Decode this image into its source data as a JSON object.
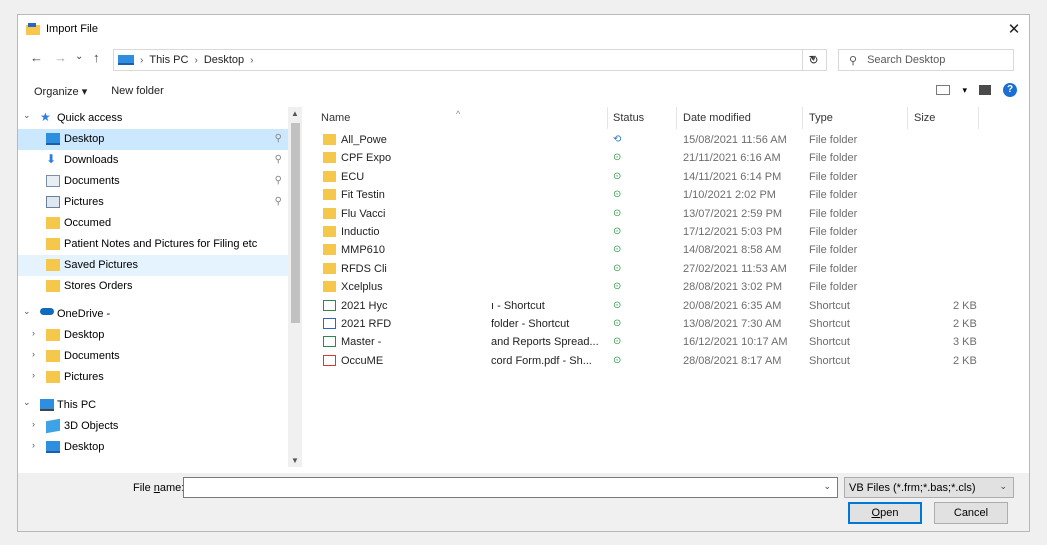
{
  "window": {
    "title": "Import File",
    "close_glyph": "✕"
  },
  "nav": {
    "back": "←",
    "forward": "→",
    "recent": "⌄",
    "up": "↑",
    "breadcrumb": [
      "This PC",
      "Desktop"
    ],
    "separator": "›",
    "refresh": "↻",
    "search_placeholder": "Search Desktop"
  },
  "toolbar": {
    "organize": "Organize ▾",
    "new_folder": "New folder",
    "view_arrow": "▾",
    "help": "?"
  },
  "sidebar": {
    "items": [
      {
        "label": "Quick access",
        "kind": "quick",
        "pinned": false
      },
      {
        "label": "Desktop",
        "kind": "desktop",
        "pinned": true
      },
      {
        "label": "Downloads",
        "kind": "download",
        "pinned": true
      },
      {
        "label": "Documents",
        "kind": "doc",
        "pinned": true
      },
      {
        "label": "Pictures",
        "kind": "pic",
        "pinned": true
      },
      {
        "label": "Occumed",
        "kind": "folder",
        "pinned": false
      },
      {
        "label": "Patient Notes and Pictures for Filing etc",
        "kind": "folder",
        "pinned": false
      },
      {
        "label": "Saved Pictures",
        "kind": "folder",
        "pinned": false
      },
      {
        "label": "Stores Orders",
        "kind": "folder",
        "pinned": false
      },
      {
        "label": "OneDrive -",
        "kind": "cloud",
        "pinned": false
      },
      {
        "label": "Desktop",
        "kind": "folder",
        "pinned": false
      },
      {
        "label": "Documents",
        "kind": "folder",
        "pinned": false
      },
      {
        "label": "Pictures",
        "kind": "folder",
        "pinned": false
      },
      {
        "label": "This PC",
        "kind": "pc",
        "pinned": false
      },
      {
        "label": "3D Objects",
        "kind": "cube",
        "pinned": false
      },
      {
        "label": "Desktop",
        "kind": "desktop",
        "pinned": false
      }
    ]
  },
  "columns": {
    "name": "Name",
    "status": "Status",
    "date": "Date modified",
    "type": "Type",
    "size": "Size"
  },
  "files": [
    {
      "name": "All_Powe",
      "name2": "",
      "status": "sync",
      "date": "15/08/2021 11:56 AM",
      "type": "File folder",
      "size": "",
      "kind": "folder"
    },
    {
      "name": "CPF Expo",
      "name2": "",
      "status": "ok",
      "date": "21/11/2021 6:16 AM",
      "type": "File folder",
      "size": "",
      "kind": "folder"
    },
    {
      "name": "ECU",
      "name2": "",
      "status": "ok",
      "date": "14/11/2021 6:14 PM",
      "type": "File folder",
      "size": "",
      "kind": "folder"
    },
    {
      "name": "Fit Testin",
      "name2": "",
      "status": "ok",
      "date": "1/10/2021 2:02 PM",
      "type": "File folder",
      "size": "",
      "kind": "folder"
    },
    {
      "name": "Flu Vacci",
      "name2": "",
      "status": "ok",
      "date": "13/07/2021 2:59 PM",
      "type": "File folder",
      "size": "",
      "kind": "folder"
    },
    {
      "name": "Inductio",
      "name2": "",
      "status": "ok",
      "date": "17/12/2021 5:03 PM",
      "type": "File folder",
      "size": "",
      "kind": "folder"
    },
    {
      "name": "MMP610",
      "name2": "",
      "status": "ok",
      "date": "14/08/2021 8:58 AM",
      "type": "File folder",
      "size": "",
      "kind": "folder"
    },
    {
      "name": "RFDS Cli",
      "name2": "",
      "status": "ok",
      "date": "27/02/2021 11:53 AM",
      "type": "File folder",
      "size": "",
      "kind": "folder"
    },
    {
      "name": "Xcelplus",
      "name2": "",
      "status": "ok",
      "date": "28/08/2021 3:02 PM",
      "type": "File folder",
      "size": "",
      "kind": "folder"
    },
    {
      "name": "2021 Hyc",
      "name2": "ı - Shortcut",
      "status": "ok",
      "date": "20/08/2021 6:35 AM",
      "type": "Shortcut",
      "size": "2 KB",
      "kind": "xls"
    },
    {
      "name": "2021 RFD",
      "name2": "folder - Shortcut",
      "status": "ok",
      "date": "13/08/2021 7:30 AM",
      "type": "Shortcut",
      "size": "2 KB",
      "kind": "doc"
    },
    {
      "name": "Master -",
      "name2": "and Reports Spread...",
      "status": "ok",
      "date": "16/12/2021 10:17 AM",
      "type": "Shortcut",
      "size": "3 KB",
      "kind": "xls"
    },
    {
      "name": "OccuME",
      "name2": "cord Form.pdf - Sh...",
      "status": "ok",
      "date": "28/08/2021 8:17 AM",
      "type": "Shortcut",
      "size": "2 KB",
      "kind": "pdf"
    }
  ],
  "footer": {
    "file_name_label_pre": "File ",
    "file_name_label_u": "n",
    "file_name_label_post": "ame:",
    "file_name_value": "",
    "file_type": "VB Files (*.frm;*.bas;*.cls)",
    "open_u": "O",
    "open_rest": "pen",
    "cancel": "Cancel"
  },
  "colors": {
    "folder": "#f5c84c",
    "selected": "#cce8ff",
    "accent": "#0078d7",
    "status_ok": "#2e9a48",
    "sync": "#2577c9"
  }
}
